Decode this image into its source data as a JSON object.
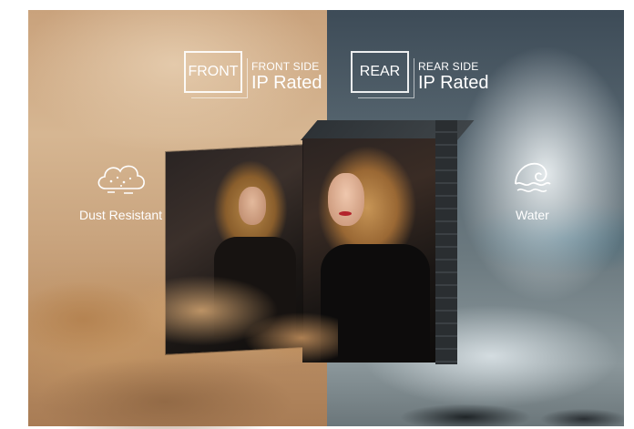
{
  "front": {
    "badge": "FRONT",
    "side_label": "FRONT SIDE",
    "rating": "IP Rated"
  },
  "rear": {
    "badge": "REAR",
    "side_label": "REAR SIDE",
    "rating": "IP Rated"
  },
  "features": {
    "dust": {
      "label": "Dust Resistant",
      "icon": "dust-cloud-icon"
    },
    "water": {
      "label": "Water",
      "icon": "water-wave-icon"
    }
  },
  "colors": {
    "dust_side": "#c9a27c",
    "water_side": "#56656f",
    "text": "#ffffff"
  }
}
